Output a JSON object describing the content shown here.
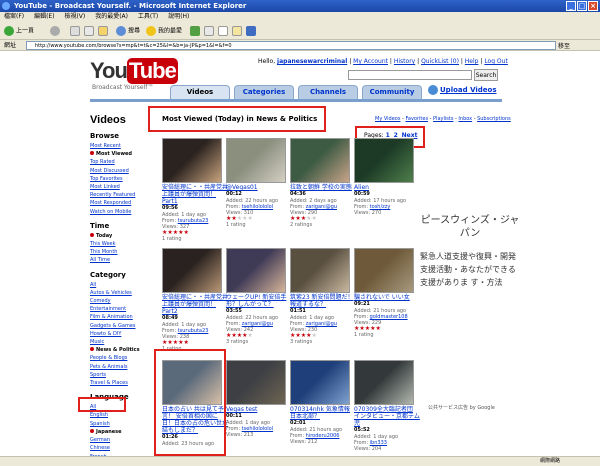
{
  "window": {
    "title": "YouTube - Broadcast Yourself. - Microsoft Internet Explorer"
  },
  "menubar": [
    "檔案(F)",
    "編輯(E)",
    "檢視(V)",
    "我的最愛(A)",
    "工具(T)",
    "說明(H)"
  ],
  "toolbar": {
    "back": "上一頁",
    "search": "搜尋",
    "favorites": "我的最愛"
  },
  "address": {
    "label": "網址",
    "url": "http://www.youtube.com/browse?s=mp&t=t&c=25&l=&b=ja-JP&p=1&l=&f=0",
    "go": "移至"
  },
  "header": {
    "logo_you": "You",
    "logo_tube": "Tube",
    "tagline": "Broadcast Yourself™",
    "hello": "Hello,",
    "username": "japanesewarcriminal",
    "links": [
      "My Account",
      "History",
      "QuickList (0)",
      "Help",
      "Log Out"
    ],
    "search_button": "Search",
    "tabs": [
      "Videos",
      "Categories",
      "Channels",
      "Community"
    ],
    "upload": "Upload Videos"
  },
  "main": {
    "page_title": "Videos",
    "headline": "Most Viewed (Today) in News & Politics",
    "sublinks": [
      "My Videos",
      "Favorites",
      "Playlists",
      "Inbox",
      "Subscriptions"
    ],
    "pages_label": "Pages:",
    "pages": [
      "1",
      "2",
      "Next"
    ]
  },
  "sidebar": {
    "browse_title": "Browse",
    "browse": [
      "Most Recent",
      "Most Viewed",
      "Top Rated",
      "Most Discussed",
      "Top Favorites",
      "Most Linked",
      "Recently Featured",
      "Most Responded",
      "Watch on Mobile"
    ],
    "browse_selected": 1,
    "time_title": "Time",
    "time": [
      "Today",
      "This Week",
      "This Month",
      "All Time"
    ],
    "time_selected": 0,
    "category_title": "Category",
    "category": [
      "All",
      "Autos & Vehicles",
      "Comedy",
      "Entertainment",
      "Film & Animation",
      "Gadgets & Games",
      "Howto & DIY",
      "Music",
      "News & Politics",
      "People & Blogs",
      "Pets & Animals",
      "Sports",
      "Travel & Places"
    ],
    "category_selected": 8,
    "language_title": "Language",
    "language": [
      "All",
      "English",
      "Spanish",
      "Japanese",
      "German",
      "Chinese",
      "French"
    ],
    "language_selected": 3
  },
  "videos": [
    {
      "title": "安倍総理に・・共産党井上議員が爆弾質問！ Part1",
      "duration": "09:56",
      "added": "1 day ago",
      "from": "tsurubuta23",
      "views": "327",
      "rating": 5,
      "ratings": "1 rating",
      "colors": [
        "#2b2320",
        "#c7a37e"
      ]
    },
    {
      "title": "@Vegas01",
      "duration": "00:12",
      "added": "22 hours ago",
      "from": "tsehilolololol",
      "views": "310",
      "rating": 2,
      "ratings": "1 rating",
      "colors": [
        "#8a8f7e",
        "#d4cfc3"
      ]
    },
    {
      "title": "拉致と朝鮮 学校の実態",
      "duration": "04:36",
      "added": "2 days ago",
      "from": "zarigani@gu",
      "views": "290",
      "rating": 3,
      "ratings": "2 ratings",
      "colors": [
        "#3d5a43",
        "#c8a48a"
      ]
    },
    {
      "title": "Alien",
      "duration": "00:59",
      "added": "17 hours ago",
      "from": "tosh/zzy",
      "views": "270",
      "rating": 0,
      "ratings": "",
      "colors": [
        "#1d3a26",
        "#4f7f4c"
      ]
    },
    {
      "title": "安倍総理に・・共産党井上議員が爆弾質問！ Part2",
      "duration": "08:49",
      "added": "1 day ago",
      "from": "tsurubuta23",
      "views": "238",
      "rating": 5,
      "ratings": "1 rating",
      "colors": [
        "#2a2220",
        "#b89775"
      ]
    },
    {
      "title": "ウェークUP! 新安倍手形？しんがって？",
      "duration": "03:55",
      "added": "22 hours ago",
      "from": "zarigani@gu",
      "views": "242",
      "rating": 4,
      "ratings": "3 ratings",
      "colors": [
        "#3f3a56",
        "#d6b59a"
      ]
    },
    {
      "title": "筑紫23 新安倍問題だ！報道するな？",
      "duration": "01:51",
      "added": "1 day ago",
      "from": "zarigani@gu",
      "views": "230",
      "rating": 4,
      "ratings": "3 ratings",
      "colors": [
        "#5a5040",
        "#c9b8a0"
      ]
    },
    {
      "title": "騙されないで いい女",
      "duration": "09:21",
      "added": "21 hours ago",
      "from": "goldmaster108",
      "views": "229",
      "rating": 5,
      "ratings": "1 rating",
      "colors": [
        "#6e5a3a",
        "#a89a7e"
      ]
    },
    {
      "title": "日本の占い 共は見て予言！ 安倍首相の国に日！日本の占の危い世だ 結もしまだ？",
      "duration": "01:26",
      "added": "23 hours ago",
      "from": "",
      "views": "",
      "rating": 0,
      "ratings": "",
      "colors": [
        "#5b6a7b",
        "#d7c0a7"
      ]
    },
    {
      "title": "Vegas test",
      "duration": "00:11",
      "added": "1 day ago",
      "from": "tsehilolololol",
      "views": "213",
      "rating": 0,
      "ratings": "",
      "colors": [
        "#3d3f44",
        "#6e6553"
      ]
    },
    {
      "title": "070314nhk 気象情報 日本北部？",
      "duration": "02:01",
      "added": "21 hours ago",
      "from": "hiroderu2006",
      "views": "212",
      "rating": 0,
      "ratings": "",
      "colors": [
        "#1f3f7a",
        "#7fa2cf"
      ]
    },
    {
      "title": "070309全大臨記者団 インタビュー・京都テム児",
      "duration": "05:52",
      "added": "1 day ago",
      "from": "ibn333",
      "views": "204",
      "rating": 0,
      "ratings": "",
      "colors": [
        "#33393a",
        "#b3b8b0"
      ]
    }
  ],
  "labels": {
    "added": "Added:",
    "from": "From:",
    "views": "Views:"
  },
  "ad": {
    "title": "ピースウィンズ・ジャパン",
    "body": "緊急人道支援や復興・開発支援活動・あなたができる支援がありま す・方法",
    "footer": "公共サービス広告 by Google"
  },
  "status": {
    "zone": "網際網路"
  }
}
